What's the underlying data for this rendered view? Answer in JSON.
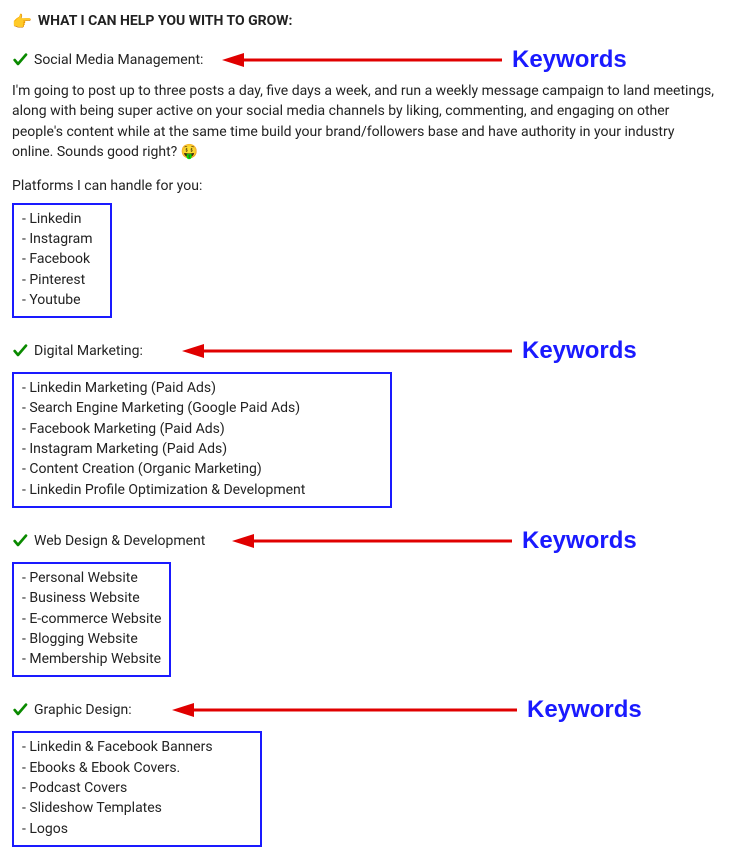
{
  "title": "WHAT I CAN HELP YOU WITH TO GROW:",
  "description": "I'm going to post up to three posts a day, five days a week, and run a weekly message campaign to land meetings, along with being super active on your social media channels by liking, commenting, and engaging on other people's content while at the same time build your brand/followers base and have authority in your industry online. Sounds good right? 🤑",
  "platforms_intro": "Platforms I can handle for you:",
  "keywords_label": "Keywords",
  "sections": {
    "s1": {
      "label": "Social Media Management:",
      "items": [
        "- Linkedin",
        "- Instagram",
        "- Facebook",
        "- Pinterest",
        "- Youtube"
      ]
    },
    "s2": {
      "label": "Digital Marketing:",
      "items": [
        "- Linkedin Marketing (Paid Ads)",
        "- Search Engine Marketing (Google Paid Ads)",
        "- Facebook Marketing (Paid Ads)",
        "- Instagram Marketing (Paid Ads)",
        "- Content Creation (Organic Marketing)",
        "- Linkedin Profile Optimization & Development"
      ]
    },
    "s3": {
      "label": "Web Design & Development",
      "items": [
        "- Personal Website",
        "- Business Website",
        "- E-commerce Website",
        "- Blogging Website",
        "- Membership Website"
      ]
    },
    "s4": {
      "label": "Graphic Design:",
      "items": [
        "- Linkedin & Facebook Banners",
        "- Ebooks & Ebook Covers.",
        "- Podcast Covers",
        "- Slideshow Templates",
        "- Logos"
      ]
    }
  }
}
